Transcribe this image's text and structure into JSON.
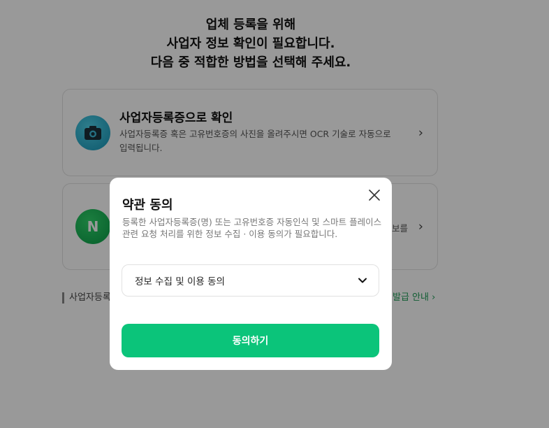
{
  "heading": {
    "line1": "업체 등록을 위해",
    "line2": "사업자 정보 확인이 필요합니다.",
    "line3": "다음 중 적합한 방법을 선택해 주세요."
  },
  "cards": [
    {
      "title": "사업자등록증으로 확인",
      "desc": "사업자등록증 혹은 고유번호증의 사진을 올려주시면 OCR 기술로 자동으로 입력됩니다.",
      "chevron": "›"
    },
    {
      "icon_letter": "N",
      "tail_text": "보를",
      "chevron": "›"
    }
  ],
  "footnote": {
    "label": "사업자등록",
    "link_tail": "발급 안내 ›"
  },
  "modal": {
    "title": "약관 동의",
    "desc": "등록한 사업자등록증(명) 또는 고유번호증 자동인식 및 스마트 플레이스 관련 요청 처리를 위한 정보 수집 · 이용 동의가 필요합니다.",
    "select_label": "정보 수집 및 이용 동의",
    "agree_button": "동의하기"
  },
  "colors": {
    "accent": "#0bc47a",
    "link": "#1f9d57",
    "overlay": "rgba(0,0,0,0.4)"
  }
}
